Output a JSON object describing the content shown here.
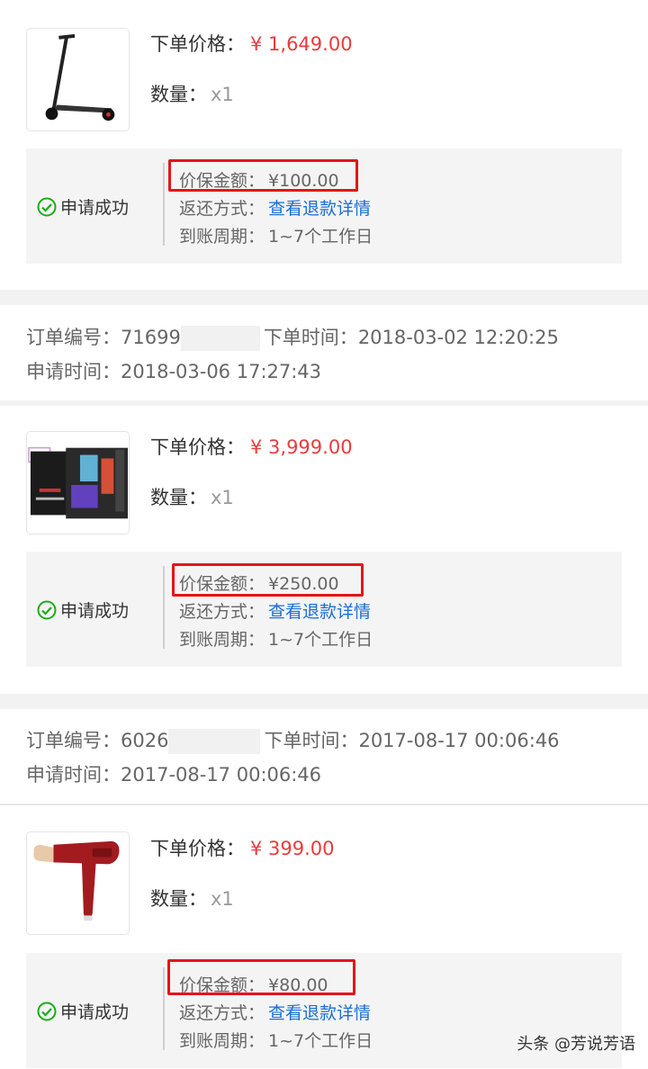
{
  "labels": {
    "order_price": "下单价格：",
    "quantity": "数量：",
    "protection_amount": "价保金额：",
    "refund_method": "返还方式：",
    "arrival_period": "到账周期：",
    "order_no": "订单编号：",
    "order_time": "下单时间：",
    "apply_time": "申请时间："
  },
  "products": [
    {
      "image": "electric-scooter",
      "price": "¥ 1,649.00",
      "quantity": "x1",
      "status": "申请成功",
      "protection_amount": "¥100.00",
      "refund_link": "查看退款详情",
      "arrival_period": "1~7个工作日"
    },
    {
      "image": "gaming-motherboard",
      "price": "¥ 3,999.00",
      "quantity": "x1",
      "status": "申请成功",
      "protection_amount": "¥250.00",
      "refund_link": "查看退款详情",
      "arrival_period": "1~7个工作日"
    },
    {
      "image": "hair-dryer",
      "price": "¥ 399.00",
      "quantity": "x1",
      "status": "申请成功",
      "protection_amount": "¥80.00",
      "refund_link": "查看退款详情",
      "arrival_period": "1~7个工作日"
    }
  ],
  "orders": [
    {
      "order_no": "71699",
      "order_time": "2018-03-02 12:20:25",
      "apply_time": "2018-03-06 17:27:43"
    },
    {
      "order_no": "6026",
      "order_time": "2017-08-17 00:06:46",
      "apply_time": "2017-08-17 00:06:46"
    }
  ],
  "colors": {
    "price_red": "#e93b3d",
    "link_blue": "#1a6fd6",
    "success_green": "#1aad19",
    "highlight_red": "#e3151a"
  },
  "watermark": "头条 @芳说芳语"
}
